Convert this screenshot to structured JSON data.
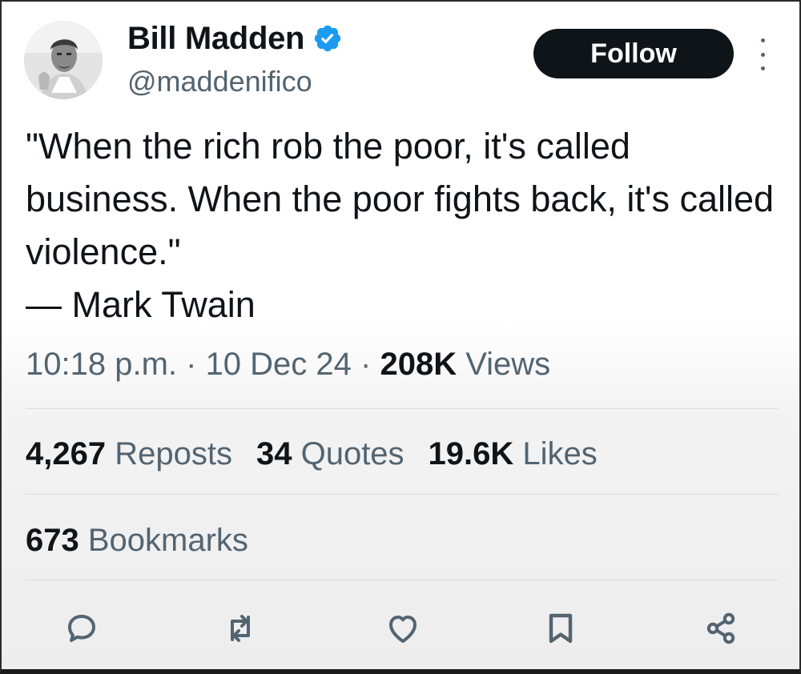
{
  "author": {
    "display_name": "Bill Madden",
    "handle": "@maddenifico"
  },
  "follow_label": "Follow",
  "tweet": {
    "text": "\"When the rich rob the poor, it's called business. When the poor fights back, it's called violence.\"\n— Mark Twain"
  },
  "meta": {
    "time": "10:18 p.m.",
    "sep1": " · ",
    "date": "10 Dec 24",
    "sep2": " · ",
    "views_count": "208K",
    "views_label": " Views"
  },
  "stats": {
    "reposts_count": "4,267",
    "reposts_label": " Reposts",
    "quotes_count": "34",
    "quotes_label": " Quotes",
    "likes_count": "19.6K",
    "likes_label": " Likes",
    "bookmarks_count": "673",
    "bookmarks_label": " Bookmarks"
  },
  "icons": {
    "verified": "verified-badge-icon",
    "more": "more-vertical-icon",
    "reply": "reply-icon",
    "repost": "repost-icon",
    "like": "heart-icon",
    "bookmark": "bookmark-icon",
    "share": "share-icon"
  },
  "colors": {
    "verified_blue": "#1d9bf0",
    "text_primary": "#0f1419",
    "text_secondary": "#536471",
    "follow_bg": "#0f1419"
  }
}
